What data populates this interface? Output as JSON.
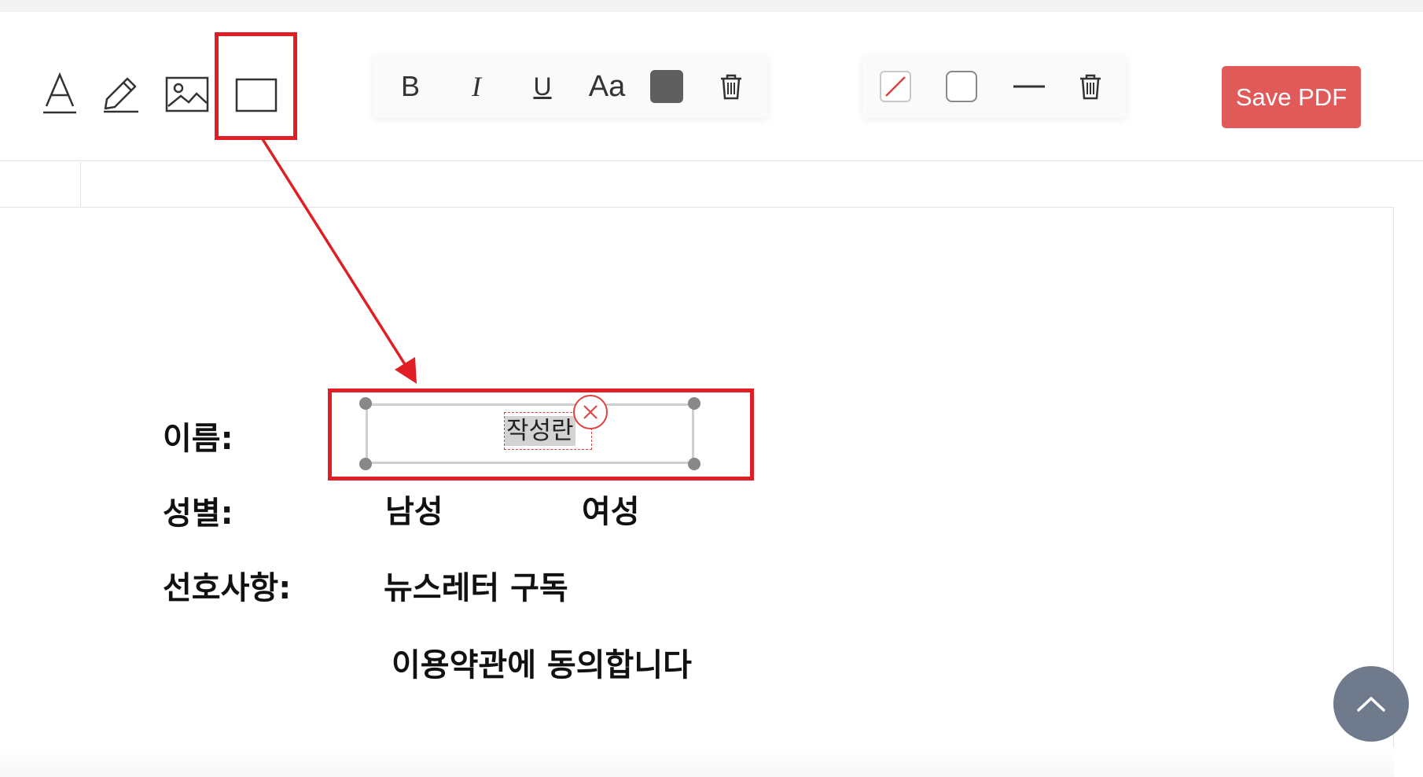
{
  "toolbar": {
    "tools": [
      {
        "icon": "text-tool-icon"
      },
      {
        "icon": "pencil-icon"
      },
      {
        "icon": "image-icon"
      },
      {
        "icon": "rectangle-icon"
      }
    ],
    "text_panel": {
      "bold_label": "B",
      "italic_label": "I",
      "underline_label": "U",
      "font_size_label": "Aa",
      "text_color": "#5f5f5f",
      "delete_icon": "trash-icon"
    },
    "shape_panel": {
      "no_fill_icon": "no-fill-icon",
      "border_color_icon": "border-color-icon",
      "line_style_icon": "line-style-icon",
      "delete_icon": "trash-icon"
    },
    "save_label": "Save PDF",
    "save_color": "#e05a5a"
  },
  "form": {
    "name_label": "이름:",
    "name_field_value": "작성란",
    "gender_label": "성별:",
    "gender_options": [
      "남성",
      "여성"
    ],
    "preferences_label": "선호사항:",
    "newsletter_label": "뉴스레터 구독",
    "terms_label": "이용약관에 동의합니다"
  },
  "annotation_color": "#e01e26"
}
